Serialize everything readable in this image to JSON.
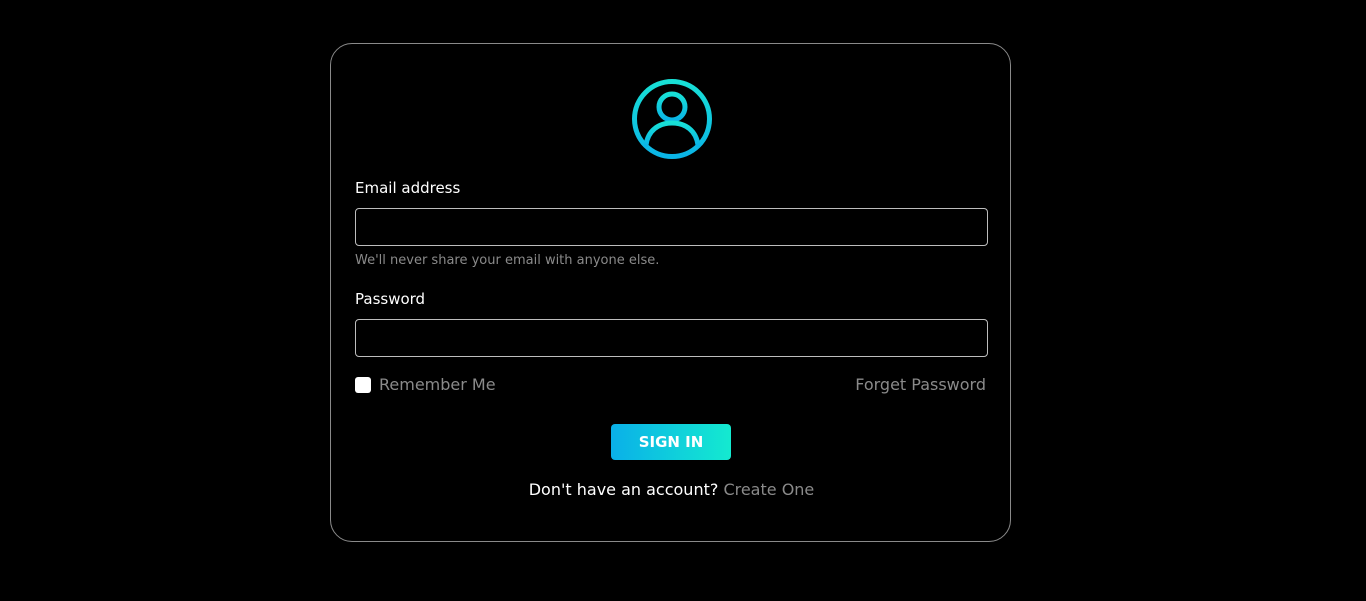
{
  "form": {
    "avatar_icon": "user-circle-icon",
    "email_label": "Email address",
    "email_value": "",
    "email_help": "We'll never share your email with anyone else.",
    "password_label": "Password",
    "password_value": "",
    "remember_label": "Remember Me",
    "remember_checked": false,
    "forgot_label": "Forget Password",
    "submit_label": "SIGN IN",
    "signup_prompt": "Don't have an account?",
    "signup_link": "Create One"
  },
  "colors": {
    "background": "#000000",
    "accent_start": "#0ab0e8",
    "accent_end": "#14ead0",
    "muted_text": "#8a8a8a"
  }
}
